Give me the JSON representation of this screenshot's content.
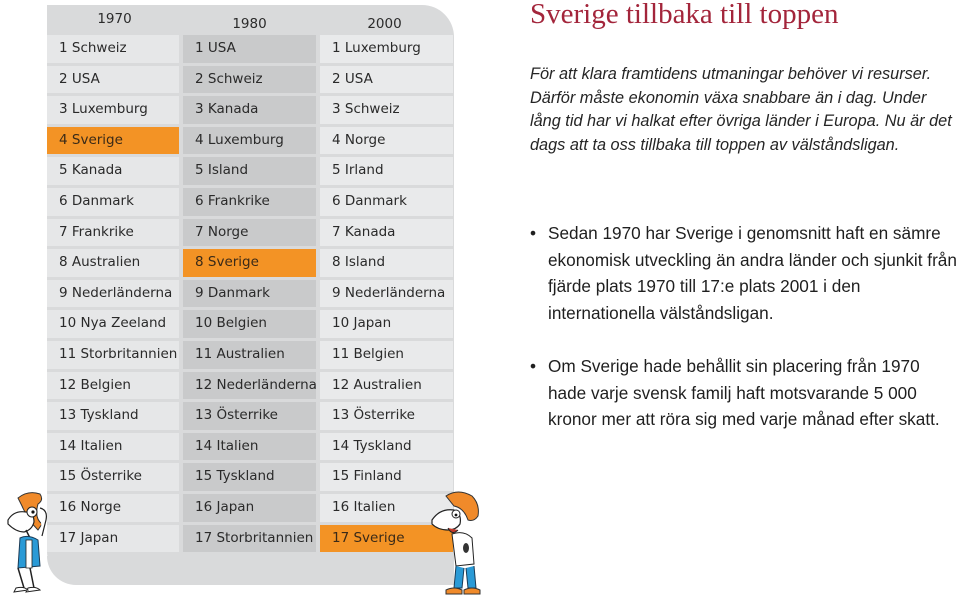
{
  "table": {
    "headers": [
      "1970",
      "1980",
      "2000"
    ],
    "highlight_color": "#f39325",
    "columns": [
      {
        "year": "1970",
        "rows": [
          "1 Schweiz",
          "2 USA",
          "3 Luxemburg",
          "4 Sverige",
          "5 Kanada",
          "6 Danmark",
          "7 Frankrike",
          "8 Australien",
          "9 Nederländerna",
          "10 Nya Zeeland",
          "11 Storbritannien",
          "12 Belgien",
          "13 Tyskland",
          "14 Italien",
          "15 Österrike",
          "16 Norge",
          "17 Japan"
        ],
        "highlighted_index": 3
      },
      {
        "year": "1980",
        "rows": [
          "1 USA",
          "2 Schweiz",
          "3 Kanada",
          "4 Luxemburg",
          "5 Island",
          "6 Frankrike",
          "7 Norge",
          "8 Sverige",
          "9 Danmark",
          "10 Belgien",
          "11 Australien",
          "12 Nederländerna",
          "13 Österrike",
          "14 Italien",
          "15 Tyskland",
          "16 Japan",
          "17 Storbritannien"
        ],
        "highlighted_index": 7
      },
      {
        "year": "2000",
        "rows": [
          "1 Luxemburg",
          "2 USA",
          "3 Schweiz",
          "4 Norge",
          "5 Irland",
          "6 Danmark",
          "7 Kanada",
          "8 Island",
          "9 Nederländerna",
          "10 Japan",
          "11 Belgien",
          "12 Australien",
          "13 Österrike",
          "14 Tyskland",
          "15 Finland",
          "16 Italien",
          "17 Sverige"
        ],
        "highlighted_index": 16
      }
    ]
  },
  "article": {
    "title": "Sverige tillbaka till toppen",
    "title_color": "#a3253b",
    "intro": "För att klara framtidens utmaningar behöver vi resurser. Därför måste ekonomin växa snabbare än i dag. Under lång tid har vi halkat efter övriga länder i Europa. Nu är det dags att ta oss tillbaka till toppen av välståndsligan.",
    "bullets": [
      "Sedan 1970 har Sverige i genomsnitt haft en sämre ekonomisk utveckling än andra länder och sjunkit från fjärde plats 1970 till 17:e plats 2001 i den internationella välståndsligan.",
      "Om Sverige hade behållit sin placering från 1970 hade varje svensk familj haft motsvarande 5 000 kronor mer att röra sig med varje månad efter skatt."
    ],
    "bullet_glyph": "•"
  },
  "illustrations": [
    "cartoon-character-scratching-head",
    "cartoon-character-surprised"
  ]
}
